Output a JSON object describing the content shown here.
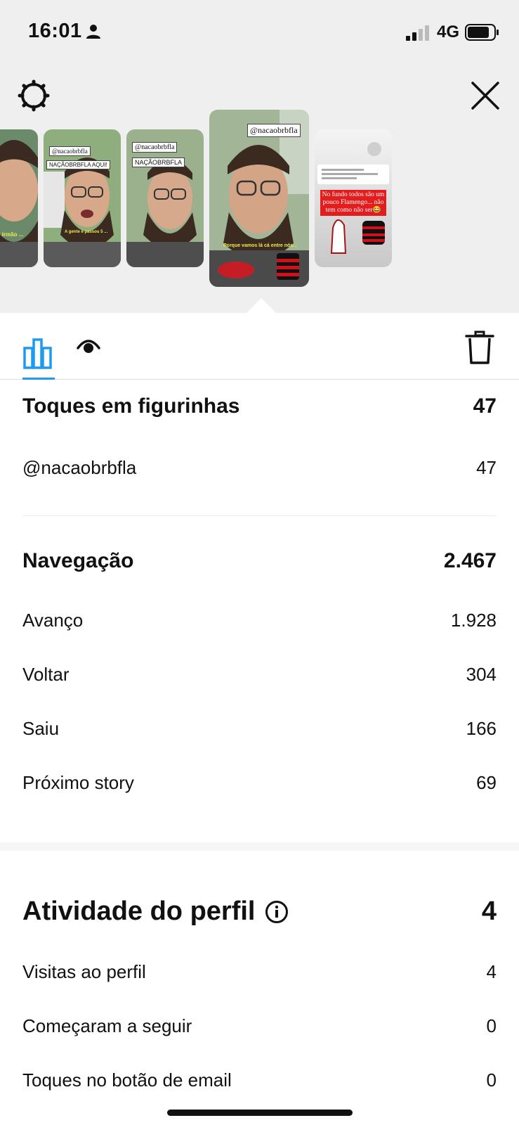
{
  "status_bar": {
    "time": "16:01",
    "network": "4G"
  },
  "stories": [
    {
      "caption": "...do irmão ..."
    },
    {
      "sticker": "@nacaobrbfla",
      "sticker2": "NAÇÃOBRBFLA AQUI!",
      "caption": "A gente é passou 5 ..."
    },
    {
      "sticker": "@nacaobrbfla",
      "sticker2": "NAÇÃOBRBFLA"
    },
    {
      "sticker": "@nacaobrbfla",
      "caption": "Porque vamos lá cá entre nós..."
    },
    {
      "post_text": "No fundo todos são um pouco Flamengo... não tem como não ser😂"
    }
  ],
  "sections": {
    "stickers": {
      "title": "Toques em figurinhas",
      "total": "47",
      "rows": [
        {
          "label": "@nacaobrbfla",
          "value": "47"
        }
      ]
    },
    "navigation": {
      "title": "Navegação",
      "total": "2.467",
      "rows": [
        {
          "label": "Avanço",
          "value": "1.928"
        },
        {
          "label": "Voltar",
          "value": "304"
        },
        {
          "label": "Saiu",
          "value": "166"
        },
        {
          "label": "Próximo story",
          "value": "69"
        }
      ]
    },
    "profile": {
      "title": "Atividade do perfil",
      "total": "4",
      "rows": [
        {
          "label": "Visitas ao perfil",
          "value": "4"
        },
        {
          "label": "Começaram a seguir",
          "value": "0"
        },
        {
          "label": "Toques no botão de email",
          "value": "0"
        }
      ]
    }
  },
  "colors": {
    "accent": "#1d9bf0",
    "flamengo_red": "#d0101b"
  }
}
